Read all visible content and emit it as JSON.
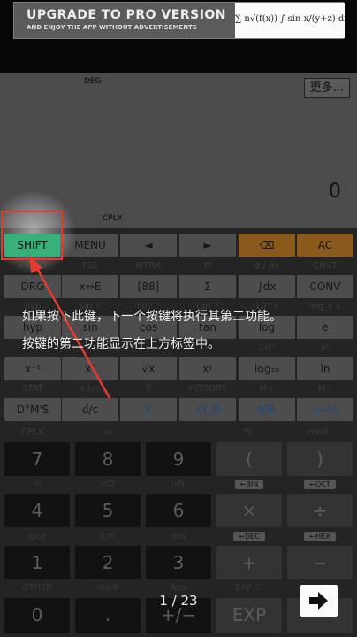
{
  "ad": {
    "title": "UPGRADE TO PRO VERSION",
    "subtitle": "AND ENJOY THE APP WITHOUT ADVERTISEMENTS",
    "formula": "∑ n√(f(x)) ∫ sin x/(y+z) dx"
  },
  "display": {
    "angle_mode": "DEG",
    "more_label": "更多...",
    "result": "0",
    "mode_label": "CPLX"
  },
  "keypad": {
    "r1": {
      "shift": "SHIFT",
      "menu": "MENU",
      "left": "◄",
      "right": "►",
      "backspace": "⌫",
      "ac": "AC"
    },
    "r1_sub": [
      "←DRG",
      "FSE",
      "MTRX",
      "Π",
      "d / dx",
      "CNST"
    ],
    "r2": [
      "DRG",
      "x⇔E",
      "[88]",
      "Σ",
      "∫dx",
      "CONV"
    ],
    "r2_sub": [
      "hyp",
      "sin⁻¹",
      "cos⁻¹",
      "tan⁻¹",
      "10^x",
      "log_y x"
    ],
    "r3": [
      "hyp",
      "sin",
      "cos",
      "tan",
      "log",
      "e"
    ],
    "r3_sub": [
      "",
      "",
      "",
      "",
      "10ˣ",
      "eˣ"
    ],
    "r4": [
      "x⁻¹",
      "x²",
      "√x",
      "xʸ",
      "log₁₀",
      "ln"
    ],
    "r4_sub": [
      "STAT",
      "a b/c",
      "Y",
      "HISTORY",
      "M+",
      "M−"
    ],
    "r5": [
      "D°M'S",
      "d/c",
      "X",
      "XY,M",
      "MR",
      "x→M"
    ],
    "r5_sub": [
      "CPLX",
      "∞",
      "",
      "%",
      "",
      "mod"
    ],
    "n_row1": [
      "7",
      "8",
      "9",
      "(",
      ")"
    ],
    "n_sub1": [
      "n!",
      "nCr",
      "nPr",
      "←BIN",
      "←OCT"
    ],
    "n_row2": [
      "4",
      "5",
      "6",
      "×",
      "÷"
    ],
    "n_sub2": [
      "gcd",
      "lcm",
      "abs",
      "←DEC",
      "←HEX"
    ],
    "n_row3": [
      "1",
      "2",
      "3",
      "+",
      "−"
    ],
    "n_sub3": [
      "OTHER",
      "ran#",
      "Ans",
      "EXP SI",
      ""
    ],
    "n_row4": [
      "0",
      ".",
      "+/−",
      "EXP",
      ""
    ]
  },
  "tutorial": {
    "line1": "如果按下此键，下一个按键将执行其第二功能。",
    "line2": "按键的第二功能显示在上方标签中。",
    "page": "1 / 23",
    "next_icon": "arrow-right-icon"
  },
  "colors": {
    "highlight": "#e23b2f",
    "shift_green": "#38b07a",
    "backspace_bg": "#8a5a1c",
    "ac_bg": "#8a5a1c"
  }
}
